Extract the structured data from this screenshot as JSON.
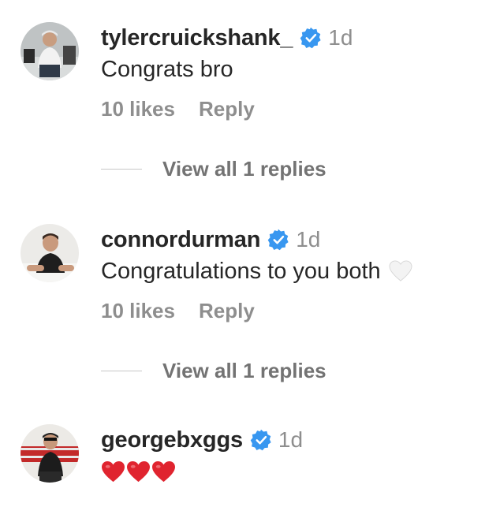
{
  "comments": [
    {
      "username": "tylercruickshank_",
      "time": "1d",
      "text": "Congrats bro",
      "likes": "10 likes",
      "reply": "Reply",
      "view_replies": "View all 1 replies"
    },
    {
      "username": "connordurman",
      "time": "1d",
      "text": "Congratulations to you both",
      "emoji": "white-heart",
      "likes": "10 likes",
      "reply": "Reply",
      "view_replies": "View all 1 replies"
    },
    {
      "username": "georgebxggs",
      "time": "1d",
      "text": "❤️❤️❤️"
    }
  ],
  "colors": {
    "text": "#262626",
    "muted": "#8e8e8e",
    "verified": "#3897f0",
    "heart_red": "#e0242f"
  }
}
